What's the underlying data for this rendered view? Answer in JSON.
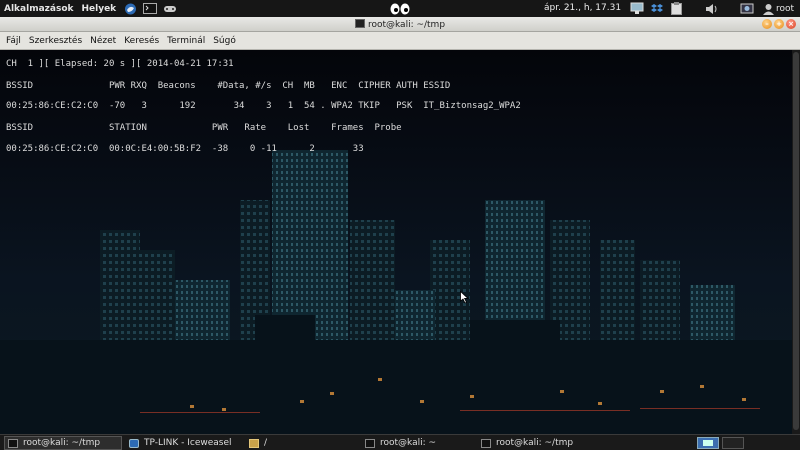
{
  "top_panel": {
    "applications": "Alkalmazások",
    "places": "Helyek",
    "clock": "ápr. 21., h, 17.31",
    "user": "root"
  },
  "window": {
    "title": "root@kali: ~/tmp"
  },
  "menubar": {
    "items": [
      "Fájl",
      "Szerkesztés",
      "Nézet",
      "Keresés",
      "Terminál",
      "Súgó"
    ]
  },
  "terminal": {
    "status_line": "CH  1 ][ Elapsed: 20 s ][ 2014-04-21 17:31",
    "ap_header": "BSSID              PWR RXQ  Beacons    #Data, #/s  CH  MB   ENC  CIPHER AUTH ESSID",
    "ap_row": "00:25:86:CE:C2:C0  -70   3      192       34    3   1  54 . WPA2 TKIP   PSK  IT_Biztonsag2_WPA2",
    "station_header": "BSSID              STATION            PWR   Rate    Lost    Frames  Probe",
    "station_row": "00:25:86:CE:C2:C0  00:0C:E4:00:5B:F2  -38    0 -11      2       33"
  },
  "taskbar": {
    "tasks": [
      {
        "label": "root@kali: ~/tmp"
      },
      {
        "label": "TP-LINK - Iceweasel"
      },
      {
        "label": "/"
      },
      {
        "label": "root@kali: ~"
      },
      {
        "label": "root@kali: ~/tmp"
      }
    ]
  },
  "colors": {
    "panel_bg": "#161616",
    "terminal_bg": "#04050a",
    "terminal_text": "#dcdcdc",
    "accent_blue": "#3b6eb0"
  }
}
